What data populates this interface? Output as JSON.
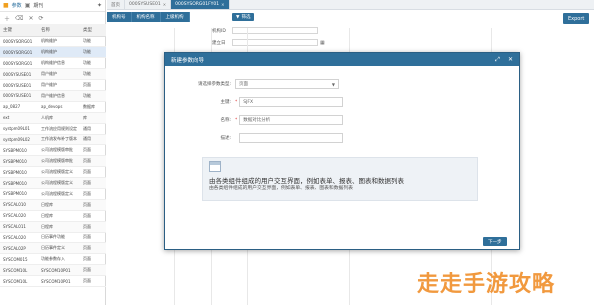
{
  "left_panel": {
    "tab_label": "参数",
    "tab2_label": "期刊",
    "columns": [
      "主键",
      "名称",
      "类型"
    ],
    "rows": [
      [
        "000SYSORG01",
        "机构维护",
        "功能"
      ],
      [
        "000SYSORG01",
        "机构维护",
        "功能"
      ],
      [
        "000SYSORG01",
        "机构维护信息",
        "功能"
      ],
      [
        "000SYSUSE01",
        "用户维护",
        "功能"
      ],
      [
        "000SYSUSE01",
        "用户维护",
        "页面"
      ],
      [
        "000SYSUSE01",
        "用户维护信息",
        "功能"
      ],
      [
        "ap_0827",
        "ap_devops",
        "数据库"
      ],
      [
        "ext",
        "人机库",
        "库"
      ],
      [
        "systpm09L01",
        "工作流应用规则设定",
        "通用"
      ],
      [
        "systpm09L02",
        "工作流发布补丁版本",
        "通用"
      ],
      [
        "SYSBPM010",
        "公司流程模版审批",
        "页面"
      ],
      [
        "SYSBPM010",
        "公司流程模版审批",
        "页面"
      ],
      [
        "SYSBPM010",
        "公司流程模版定义",
        "页面"
      ],
      [
        "SYSBPM010",
        "公司流程模版定义",
        "页面"
      ],
      [
        "SYSBPM010",
        "公司流程模版定义",
        "页面"
      ],
      [
        "SYSCAL010",
        "日程库",
        "页面"
      ],
      [
        "SYSCAL020",
        "日程库",
        "页面"
      ],
      [
        "SYSCAL011",
        "日程库",
        "页面"
      ],
      [
        "SYSCAL020",
        "日历事件功能",
        "页面"
      ],
      [
        "SYSCAL02P",
        "日历事件定义",
        "页面"
      ],
      [
        "SYSCOM015",
        "功能参数存入",
        "页面"
      ],
      [
        "SYSCOM10L",
        "SYSCOM10P01",
        "页面"
      ],
      [
        "SYSCOM10L",
        "SYSCOM10P01",
        "页面"
      ]
    ]
  },
  "top_tabs": [
    {
      "label": "首页",
      "active": false
    },
    {
      "label": "000SYSUSE01",
      "active": false
    },
    {
      "label": "000SYSORG01FY01",
      "active": true
    }
  ],
  "column_headers": [
    "机构号",
    "机构名称",
    "上级机构"
  ],
  "filter_button": "筛选",
  "export_button": "Export",
  "bg_form": {
    "field1_label": "机构ID",
    "field2_label": "建立日"
  },
  "modal": {
    "title": "新建参数向导",
    "type_label": "请选择参数类型:",
    "type_value": "页面",
    "key_label": "主键:",
    "key_value": "SJFX",
    "name_label": "名称:",
    "name_value": "数据对比分析",
    "desc_label": "描述:",
    "desc_value": "",
    "info_title": "由各类组件组成的用户交互界面，例如表单、报表、图表和数据列表",
    "info_sub": "由各类组件组成的用户交互界面，例如表单、报表、图表和数据列表",
    "next_button": "下一步"
  },
  "watermark": "走走手游攻略"
}
